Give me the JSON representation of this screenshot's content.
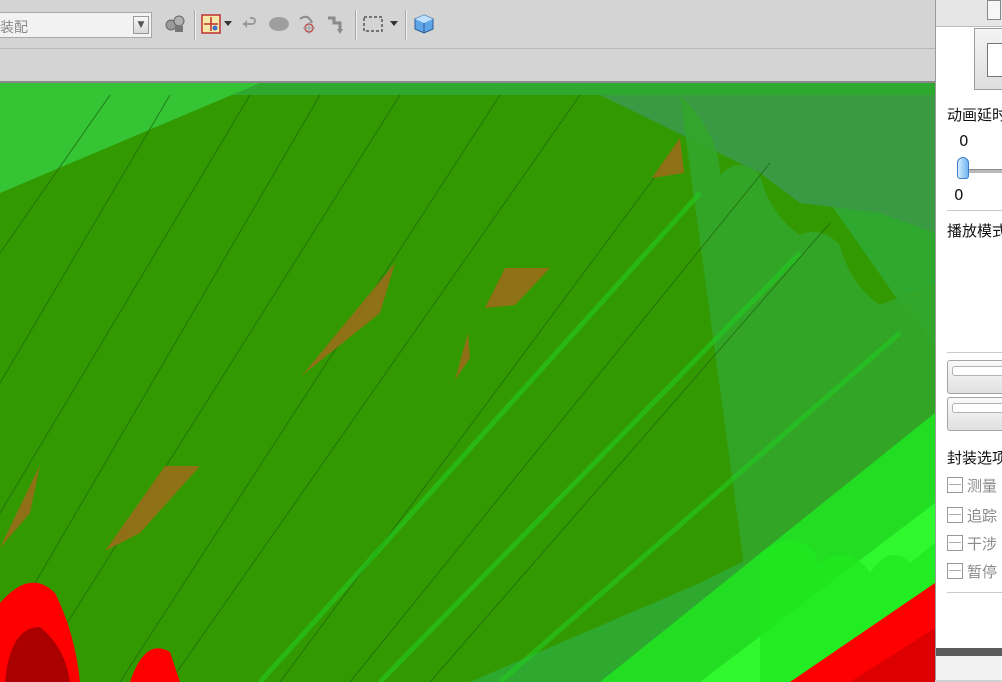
{
  "toolbar": {
    "combo_value": "装配",
    "icons": [
      "measure-icon",
      "select-box-icon",
      "dropdown-arrow-icon",
      "undo-icon",
      "shape-icon",
      "pivot-icon",
      "step-icon",
      "marquee-icon",
      "dropdown-arrow-icon",
      "3d-box-icon"
    ]
  },
  "panel": {
    "animation_delay_label": "动画延时",
    "slider_value": "0",
    "slider_min": "0",
    "play_mode_label": "播放模式",
    "package_options_label": "封装选项",
    "options": [
      {
        "label": "测量",
        "checked": false
      },
      {
        "label": "追踪",
        "checked": false
      },
      {
        "label": "干涉",
        "checked": false
      },
      {
        "label": "暂停",
        "checked": false
      }
    ]
  },
  "colors": {
    "gear_green": "#339900",
    "gear_light": "#33cc33",
    "gear_bright": "#22ee22",
    "gear_red": "#ff0000",
    "gear_dark_red": "#aa0000",
    "interference": "#a06a1a",
    "slider_thumb": "#71b5f0"
  }
}
